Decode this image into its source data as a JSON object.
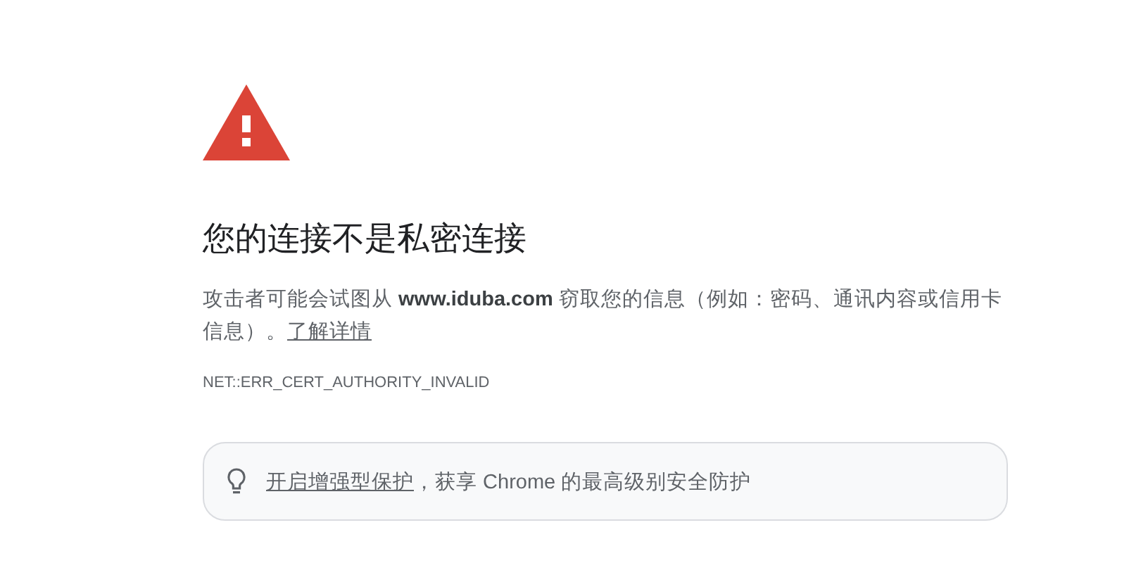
{
  "title": "您的连接不是私密连接",
  "description": {
    "text": "攻击者可能会试图从 **www.iduba.com** 窃取您的信息（例如：密码、通讯内容或信用卡信息）。",
    "link": "了解详情"
  },
  "error_code": "NET::ERR_CERT_AUTHORITY_INVALID",
  "promo": {
    "link": "开启增强型保护",
    "text": "，获享 Chrome 的最高级别安全防护"
  }
}
